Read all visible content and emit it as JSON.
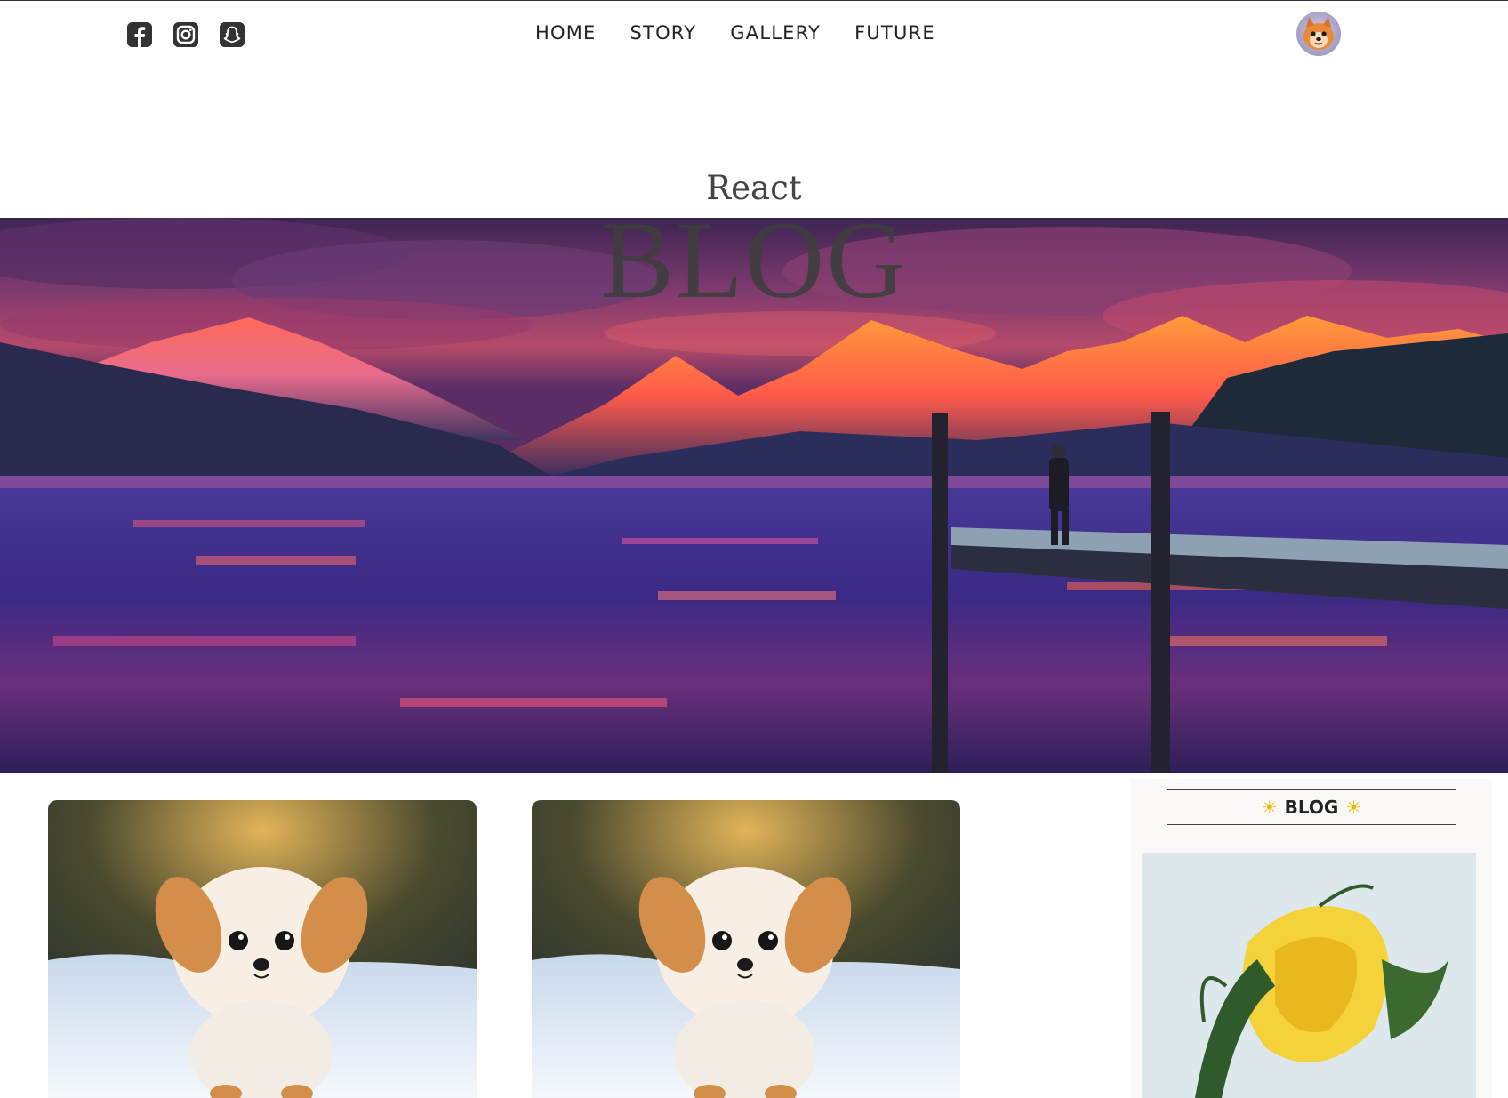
{
  "socials": [
    {
      "icon": "facebook-icon"
    },
    {
      "icon": "instagram-icon"
    },
    {
      "icon": "snapchat-icon"
    }
  ],
  "nav": {
    "items": [
      "HOME",
      "STORY",
      "GALLERY",
      "FUTURE"
    ]
  },
  "header": {
    "title_small": "React",
    "title_big": "BLOG"
  },
  "sidebar": {
    "title": "BLOG",
    "title_icon": "sun-icon"
  },
  "colors": {
    "text": "#222222",
    "title": "#444444",
    "sun": "#f2b705",
    "sidebar_bg": "#fbf8f8"
  }
}
